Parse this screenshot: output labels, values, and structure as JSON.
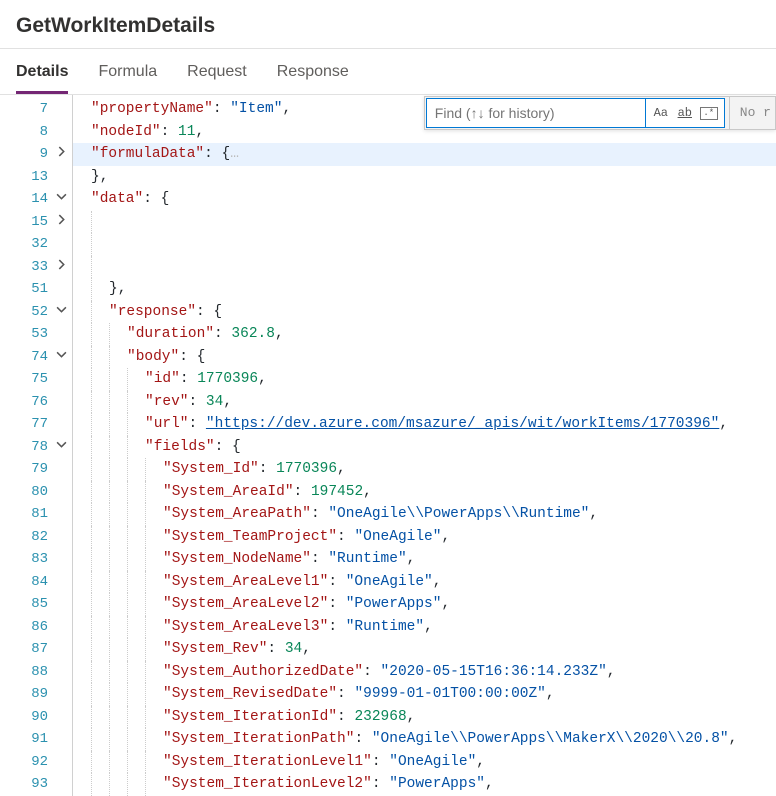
{
  "page_title": "GetWorkItemDetails",
  "tabs": {
    "details": "Details",
    "formula": "Formula",
    "request": "Request",
    "response": "Response"
  },
  "find": {
    "placeholder": "Find (↑↓ for history)",
    "case_label": "Aa",
    "word_label": "ab",
    "regex_label": ".*",
    "no_results": "No r"
  },
  "gutter": [
    {
      "n": 7,
      "f": ""
    },
    {
      "n": 8,
      "f": ""
    },
    {
      "n": 9,
      "f": ">"
    },
    {
      "n": 13,
      "f": ""
    },
    {
      "n": 14,
      "f": "v"
    },
    {
      "n": 15,
      "f": ">"
    },
    {
      "n": 32,
      "f": ""
    },
    {
      "n": 33,
      "f": ">"
    },
    {
      "n": 51,
      "f": ""
    },
    {
      "n": 52,
      "f": "v"
    },
    {
      "n": 53,
      "f": ""
    },
    {
      "n": 74,
      "f": "v"
    },
    {
      "n": 75,
      "f": ""
    },
    {
      "n": 76,
      "f": ""
    },
    {
      "n": 77,
      "f": ""
    },
    {
      "n": 78,
      "f": "v"
    },
    {
      "n": 79,
      "f": ""
    },
    {
      "n": 80,
      "f": ""
    },
    {
      "n": 81,
      "f": ""
    },
    {
      "n": 82,
      "f": ""
    },
    {
      "n": 83,
      "f": ""
    },
    {
      "n": 84,
      "f": ""
    },
    {
      "n": 85,
      "f": ""
    },
    {
      "n": 86,
      "f": ""
    },
    {
      "n": 87,
      "f": ""
    },
    {
      "n": 88,
      "f": ""
    },
    {
      "n": 89,
      "f": ""
    },
    {
      "n": 90,
      "f": ""
    },
    {
      "n": 91,
      "f": ""
    },
    {
      "n": 92,
      "f": ""
    },
    {
      "n": 93,
      "f": ""
    }
  ],
  "doc": {
    "propertyName_key": "\"propertyName\"",
    "propertyName_val": "\"Item\"",
    "nodeId_key": "\"nodeId\"",
    "nodeId_val": "11",
    "formulaData_key": "\"formulaData\"",
    "data_key": "\"data\"",
    "response_key": "\"response\"",
    "duration_key": "\"duration\"",
    "duration_val": "362.8",
    "body_key": "\"body\"",
    "id_key": "\"id\"",
    "id_val": "1770396",
    "rev_key": "\"rev\"",
    "rev_val": "34",
    "url_key": "\"url\"",
    "url_val": "\"https://dev.azure.com/msazure/_apis/wit/workItems/1770396\"",
    "fields_key": "\"fields\"",
    "f": {
      "System_Id_key": "\"System_Id\"",
      "System_Id_val": "1770396",
      "System_AreaId_key": "\"System_AreaId\"",
      "System_AreaId_val": "197452",
      "System_AreaPath_key": "\"System_AreaPath\"",
      "System_AreaPath_val": "\"OneAgile\\\\PowerApps\\\\Runtime\"",
      "System_TeamProject_key": "\"System_TeamProject\"",
      "System_TeamProject_val": "\"OneAgile\"",
      "System_NodeName_key": "\"System_NodeName\"",
      "System_NodeName_val": "\"Runtime\"",
      "System_AreaLevel1_key": "\"System_AreaLevel1\"",
      "System_AreaLevel1_val": "\"OneAgile\"",
      "System_AreaLevel2_key": "\"System_AreaLevel2\"",
      "System_AreaLevel2_val": "\"PowerApps\"",
      "System_AreaLevel3_key": "\"System_AreaLevel3\"",
      "System_AreaLevel3_val": "\"Runtime\"",
      "System_Rev_key": "\"System_Rev\"",
      "System_Rev_val": "34",
      "System_AuthorizedDate_key": "\"System_AuthorizedDate\"",
      "System_AuthorizedDate_val": "\"2020-05-15T16:36:14.233Z\"",
      "System_RevisedDate_key": "\"System_RevisedDate\"",
      "System_RevisedDate_val": "\"9999-01-01T00:00:00Z\"",
      "System_IterationId_key": "\"System_IterationId\"",
      "System_IterationId_val": "232968",
      "System_IterationPath_key": "\"System_IterationPath\"",
      "System_IterationPath_val": "\"OneAgile\\\\PowerApps\\\\MakerX\\\\2020\\\\20.8\"",
      "System_IterationLevel1_key": "\"System_IterationLevel1\"",
      "System_IterationLevel1_val": "\"OneAgile\"",
      "System_IterationLevel2_key": "\"System_IterationLevel2\"",
      "System_IterationLevel2_val": "\"PowerApps\""
    },
    "ellipsis": "…",
    "colon_brace": ": {",
    "colon_sp": ": ",
    "comma": ",",
    "brace_close_comma": "},",
    "brace_open": "{"
  }
}
